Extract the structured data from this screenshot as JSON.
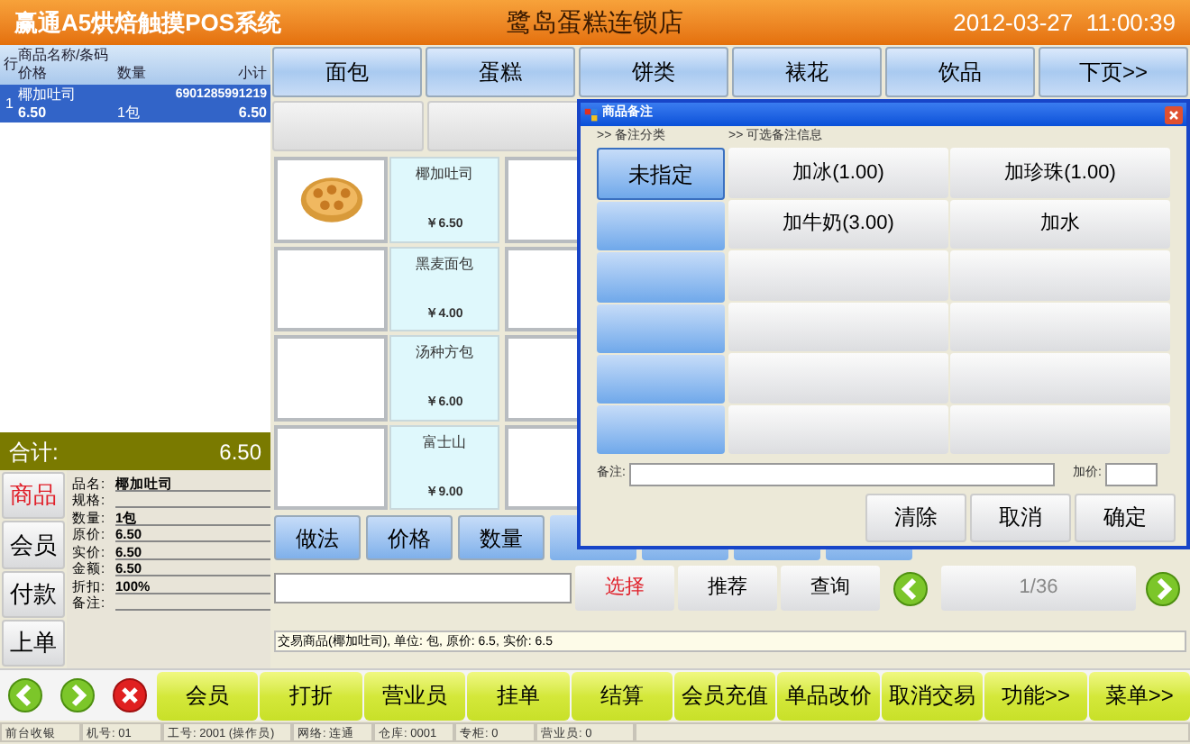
{
  "header": {
    "app_title": "赢通A5烘焙触摸POS系统",
    "store": "鹭岛蛋糕连锁店",
    "datetime": "2012-03-27  11:00:39"
  },
  "order_table": {
    "line_header": "行",
    "name_header": "商品名称/条码",
    "price_header": "价格",
    "qty_header": "数量",
    "subtotal_header": "小计",
    "rows": [
      {
        "line": "1",
        "name": "椰加吐司",
        "barcode": "6901285991219",
        "price": "6.50",
        "qty": "1包",
        "subtotal": "6.50",
        "selected": true
      }
    ]
  },
  "total": {
    "label": "合计:",
    "value": "6.50"
  },
  "side_tabs": [
    {
      "label": "商品",
      "selected": true
    },
    {
      "label": "会员",
      "selected": false
    },
    {
      "label": "付款",
      "selected": false
    },
    {
      "label": "上单",
      "selected": false
    }
  ],
  "details": [
    {
      "label": "品名:",
      "value": "椰加吐司"
    },
    {
      "label": "规格:"
    },
    {
      "label": "数量:",
      "value": "1包"
    },
    {
      "label": "原价:",
      "value": "6.50"
    },
    {
      "label": "实价:",
      "value": "6.50"
    },
    {
      "label": "金额:",
      "value": "6.50"
    },
    {
      "label": "折扣:",
      "value": "100%"
    },
    {
      "label": "备注:"
    }
  ],
  "categories": [
    "面包",
    "蛋糕",
    "饼类",
    "裱花",
    "饮品",
    "下页>>"
  ],
  "products": [
    {
      "name": "椰加吐司",
      "price": "￥6.50",
      "kind": "picture"
    },
    {
      "name": "黑麦面包",
      "price": "￥4.00",
      "kind": "blank"
    },
    {
      "name": "汤种方包",
      "price": "￥6.00",
      "kind": "blank"
    },
    {
      "name": "富士山",
      "price": "￥9.00",
      "kind": "blank"
    }
  ],
  "modify_buttons": [
    "做法",
    "价格",
    "数量"
  ],
  "search": {
    "buttons": [
      {
        "label": "选择",
        "selected": true
      },
      {
        "label": "推荐",
        "selected": false
      },
      {
        "label": "查询",
        "selected": false
      }
    ],
    "page": "1/36"
  },
  "message": "交易商品(椰加吐司), 单位: 包, 原价: 6.5, 实价: 6.5",
  "dialog": {
    "title": "商品备注",
    "category_heading": ">> 备注分类",
    "options_heading": ">> 可选备注信息",
    "categories": [
      {
        "label": "未指定",
        "selected": true
      }
    ],
    "options": [
      "加冰(1.00)",
      "加珍珠(1.00)",
      "加牛奶(3.00)",
      "加水"
    ],
    "note_label": "备注:",
    "surcharge_label": "加价:",
    "buttons": [
      "清除",
      "取消",
      "确定"
    ]
  },
  "toolbar": [
    "会员",
    "打折",
    "营业员",
    "挂单",
    "结算",
    "会员充值",
    "单品改价",
    "取消交易",
    "功能>>",
    "菜单>>"
  ],
  "status_bar": [
    "前台收银",
    "机号: 01",
    "工号: 2001 (操作员)",
    "网络: 连通",
    "仓库: 0001",
    "专柜: 0",
    "营业员: 0"
  ]
}
